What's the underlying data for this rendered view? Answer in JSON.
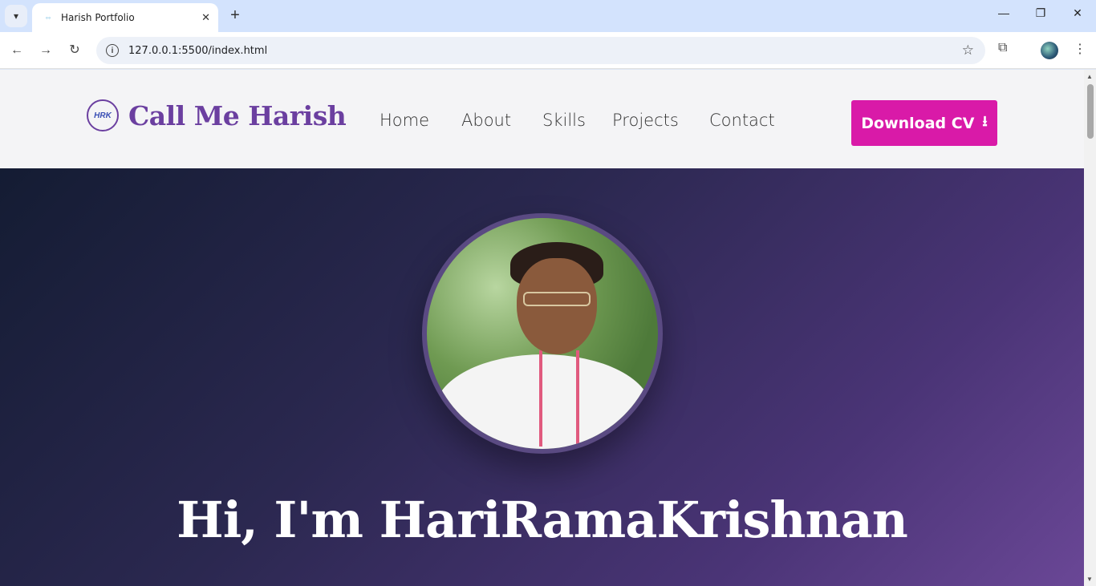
{
  "browser": {
    "tab_title": "Harish Portfolio",
    "url": "127.0.0.1:5500/index.html"
  },
  "site": {
    "logo_text": "HRK",
    "brand": "Call Me Harish",
    "nav": [
      "Home",
      "About",
      "Skills",
      "Projects",
      "Contact"
    ],
    "cta_label": "Download CV",
    "accent": "#d91aa8",
    "brand_color": "#6b3fa0"
  },
  "hero": {
    "heading": "Hi, I'm HariRamaKrishnan"
  }
}
